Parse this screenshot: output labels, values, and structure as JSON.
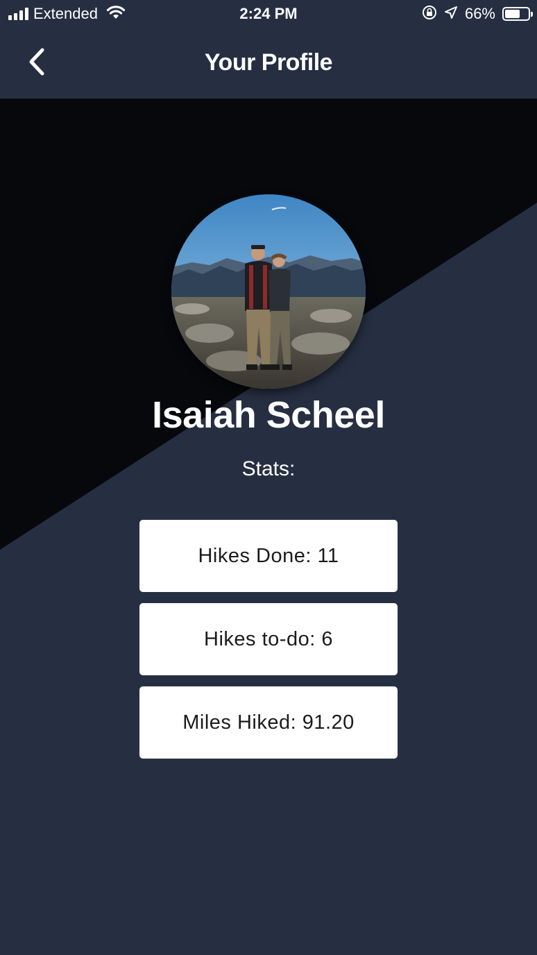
{
  "status_bar": {
    "carrier": "Extended",
    "time": "2:24 PM",
    "battery_percent": "66%",
    "battery_level": 0.66,
    "icons": [
      "signal-icon",
      "wifi-icon",
      "rotation-lock-icon",
      "location-arrow-icon",
      "battery-icon"
    ]
  },
  "header": {
    "title": "Your Profile",
    "back_icon": "chevron-left-icon"
  },
  "profile": {
    "name": "Isaiah Scheel",
    "avatar": "profile-photo"
  },
  "stats": {
    "label": "Stats:",
    "items": [
      {
        "label": "Hikes Done: 11"
      },
      {
        "label": "Hikes to-do: 6"
      },
      {
        "label": "Miles Hiked: 91.20"
      }
    ]
  },
  "colors": {
    "background": "#262f42",
    "diagonal_dark": "#07080c",
    "card": "#ffffff",
    "text": "#ffffff",
    "card_text": "#1b1b1b"
  }
}
